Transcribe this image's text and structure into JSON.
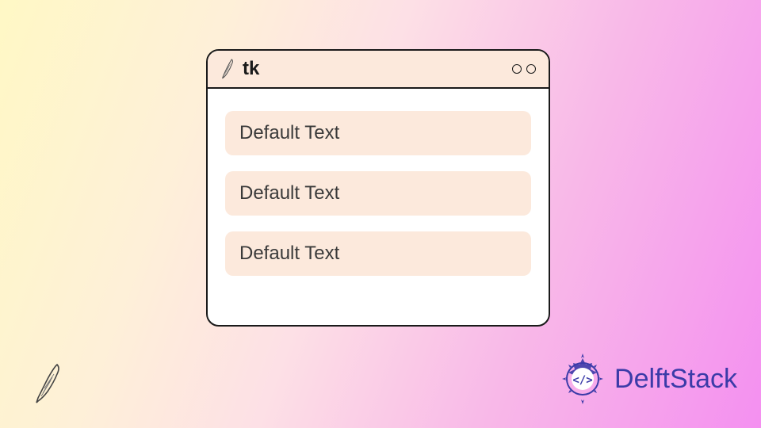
{
  "window": {
    "title": "tk",
    "inputs": [
      {
        "value": "Default Text"
      },
      {
        "value": "Default Text"
      },
      {
        "value": "Default Text"
      }
    ]
  },
  "branding": {
    "name": "DelftStack"
  },
  "icons": {
    "feather": "feather-icon",
    "ornament": "delftstack-ornament"
  }
}
